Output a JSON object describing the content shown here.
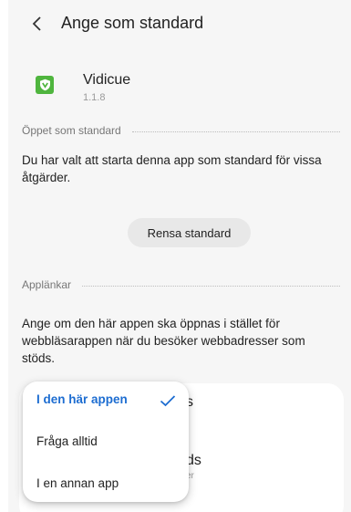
{
  "header": {
    "title": "Ange som standard"
  },
  "app": {
    "name": "Vidicue",
    "version": "1.1.8"
  },
  "open_default": {
    "heading": "Öppet som standard",
    "description": "Du har valt att starta denna app som standard för vissa åtgärder.",
    "clear_button": "Rensa standard"
  },
  "app_links": {
    "heading": "Applänkar",
    "description": "Ange om den här appen ska öppnas i stället för webbläsarappen när du besöker webbadresser som stöds."
  },
  "card": {
    "item1_fragment": "s",
    "item2_fragment": "ds",
    "item2_sub_fragment": "er"
  },
  "popup": {
    "options": [
      "I den här appen",
      "Fråga alltid",
      "I en annan app"
    ],
    "selected_index": 0
  },
  "colors": {
    "accent": "#1d6dd1",
    "app_icon": "#4fb53e",
    "background": "#f6f6f6"
  }
}
